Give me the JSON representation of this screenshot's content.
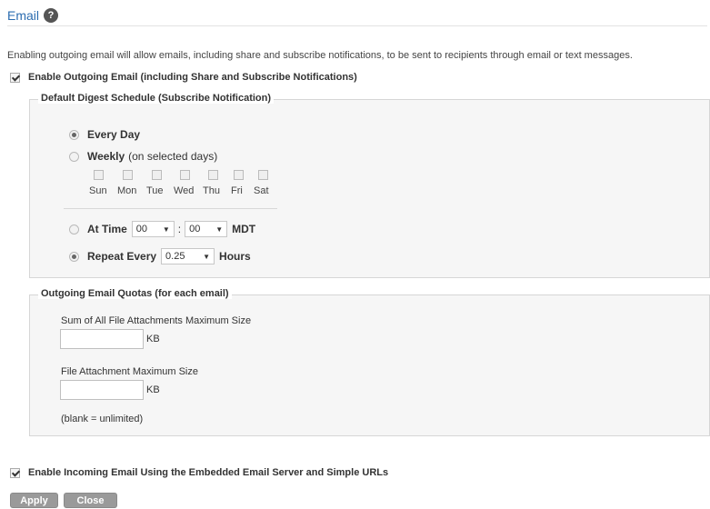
{
  "section": {
    "title": "Email",
    "help_icon": "?"
  },
  "intro": "Enabling outgoing email will allow emails, including share and subscribe notifications, to be sent to recipients through email or text messages.",
  "enable_outgoing": {
    "label": "Enable Outgoing Email (including Share and Subscribe Notifications)",
    "checked": true
  },
  "digest": {
    "legend": "Default Digest Schedule (Subscribe Notification)",
    "every_day": "Every Day",
    "weekly": "Weekly",
    "weekly_note": "(on selected days)",
    "days": [
      "Sun",
      "Mon",
      "Tue",
      "Wed",
      "Thu",
      "Fri",
      "Sat"
    ],
    "at_time": "At Time",
    "hour": "00",
    "colon": ":",
    "minute": "00",
    "timezone": "MDT",
    "repeat_every": "Repeat Every",
    "repeat_value": "0.25",
    "hours": "Hours",
    "selected": "Every Day + Repeat Every"
  },
  "quotas": {
    "legend": "Outgoing Email Quotas (for each email)",
    "sum_label": "Sum of All File Attachments Maximum Size",
    "sum_unit": "KB",
    "file_label": "File Attachment Maximum Size",
    "file_unit": "KB",
    "note": "(blank = unlimited)"
  },
  "enable_incoming": {
    "label": "Enable Incoming Email Using the Embedded Email Server and Simple URLs",
    "checked": true
  },
  "buttons": {
    "apply": "Apply",
    "close": "Close"
  }
}
